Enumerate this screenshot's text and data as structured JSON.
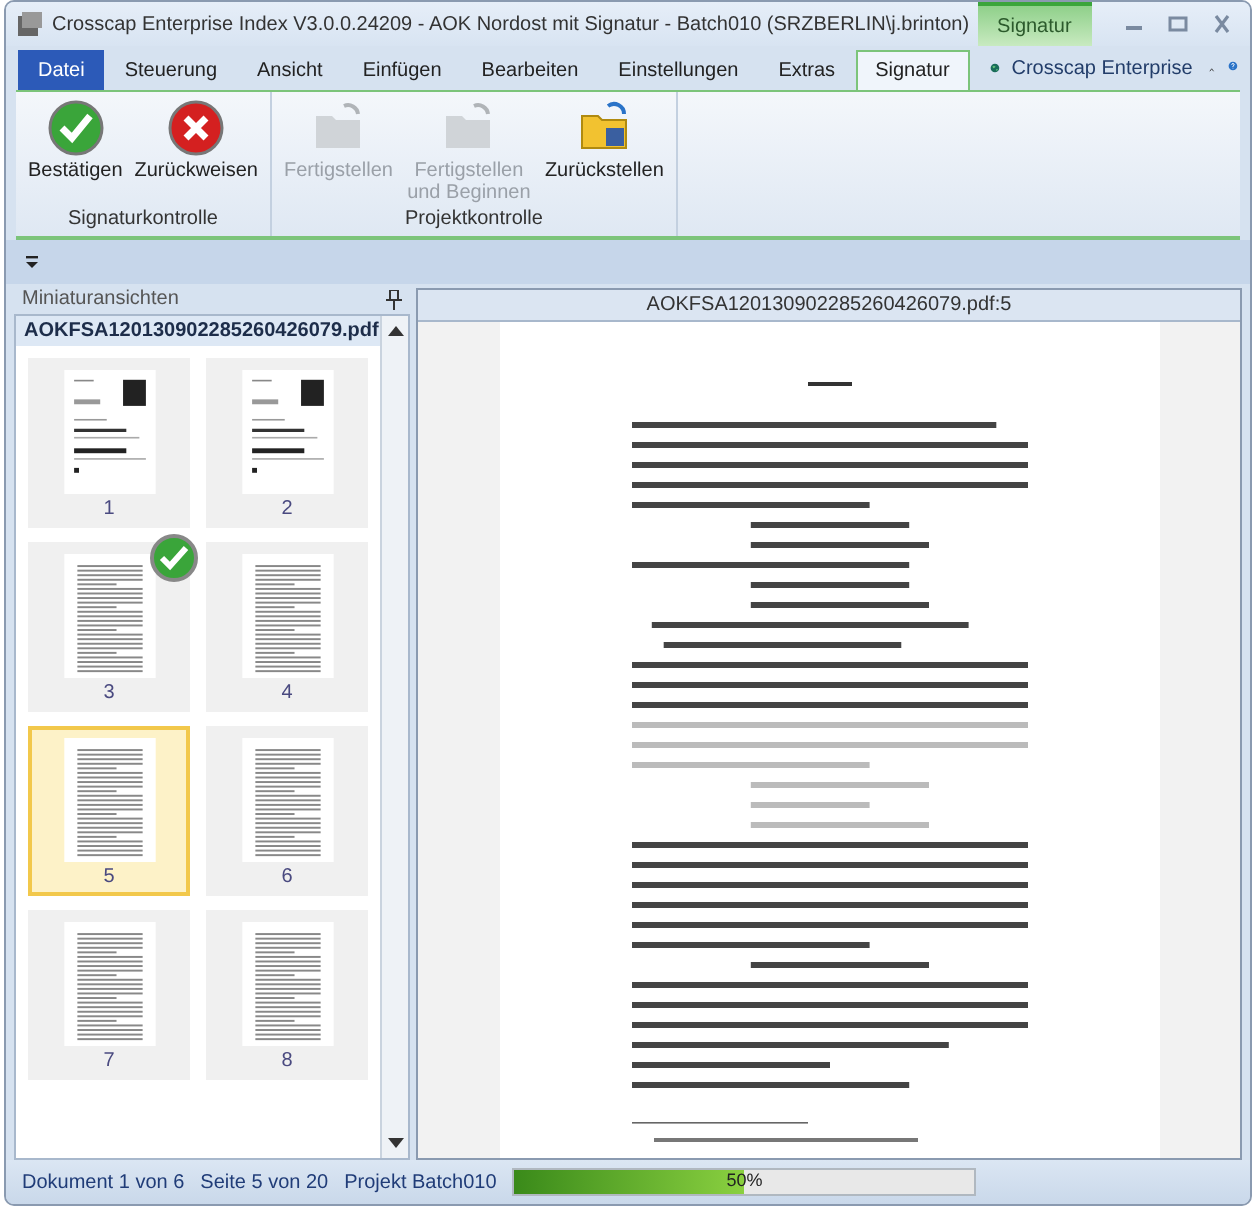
{
  "window": {
    "title": "Crosscap Enterprise Index V3.0.0.24209 - AOK Nordost mit Signatur - Batch010 (SRZBERLIN\\j.brinton)",
    "context_tab": "Signatur"
  },
  "tabs": [
    {
      "label": "Datei",
      "kind": "file",
      "selected": false
    },
    {
      "label": "Steuerung",
      "kind": "tab",
      "selected": false
    },
    {
      "label": "Ansicht",
      "kind": "tab",
      "selected": false
    },
    {
      "label": "Einfügen",
      "kind": "tab",
      "selected": false
    },
    {
      "label": "Bearbeiten",
      "kind": "tab",
      "selected": false
    },
    {
      "label": "Einstellungen",
      "kind": "tab",
      "selected": false
    },
    {
      "label": "Extras",
      "kind": "tab",
      "selected": false
    },
    {
      "label": "Signatur",
      "kind": "tab",
      "selected": true
    }
  ],
  "brand": "Crosscap Enterprise",
  "ribbon_groups": [
    {
      "label": "Signaturkontrolle",
      "buttons": [
        {
          "label": "Bestätigen",
          "kind": "confirm",
          "disabled": false
        },
        {
          "label": "Zurückweisen",
          "kind": "reject",
          "disabled": false
        }
      ]
    },
    {
      "label": "Projektkontrolle",
      "buttons": [
        {
          "label": "Fertigstellen",
          "kind": "finish",
          "disabled": true
        },
        {
          "label": "Fertigstellen und Beginnen",
          "kind": "finish-start",
          "disabled": true
        },
        {
          "label": "Zurückstellen",
          "kind": "defer",
          "disabled": false
        }
      ]
    }
  ],
  "thumbnails": {
    "title": "Miniaturansichten",
    "file": "AOKFSA120130902285260426079.pdf",
    "pages": [
      {
        "label": "1",
        "kind": "letter",
        "selected": false,
        "signed": false
      },
      {
        "label": "2",
        "kind": "letter",
        "selected": false,
        "signed": false
      },
      {
        "label": "3",
        "kind": "text",
        "selected": false,
        "signed": true
      },
      {
        "label": "4",
        "kind": "text",
        "selected": false,
        "signed": false
      },
      {
        "label": "5",
        "kind": "text",
        "selected": true,
        "signed": false
      },
      {
        "label": "6",
        "kind": "text",
        "selected": false,
        "signed": false
      },
      {
        "label": "7",
        "kind": "text",
        "selected": false,
        "signed": false
      },
      {
        "label": "8",
        "kind": "text",
        "selected": false,
        "signed": false
      }
    ]
  },
  "viewer": {
    "title": "AOKFSA120130902285260426079.pdf:5"
  },
  "status_bar": {
    "document": "Dokument 1 von 6",
    "page": "Seite 5 von 20",
    "project": "Projekt Batch010",
    "progress": {
      "level": 0.5,
      "reading": "50%"
    }
  }
}
